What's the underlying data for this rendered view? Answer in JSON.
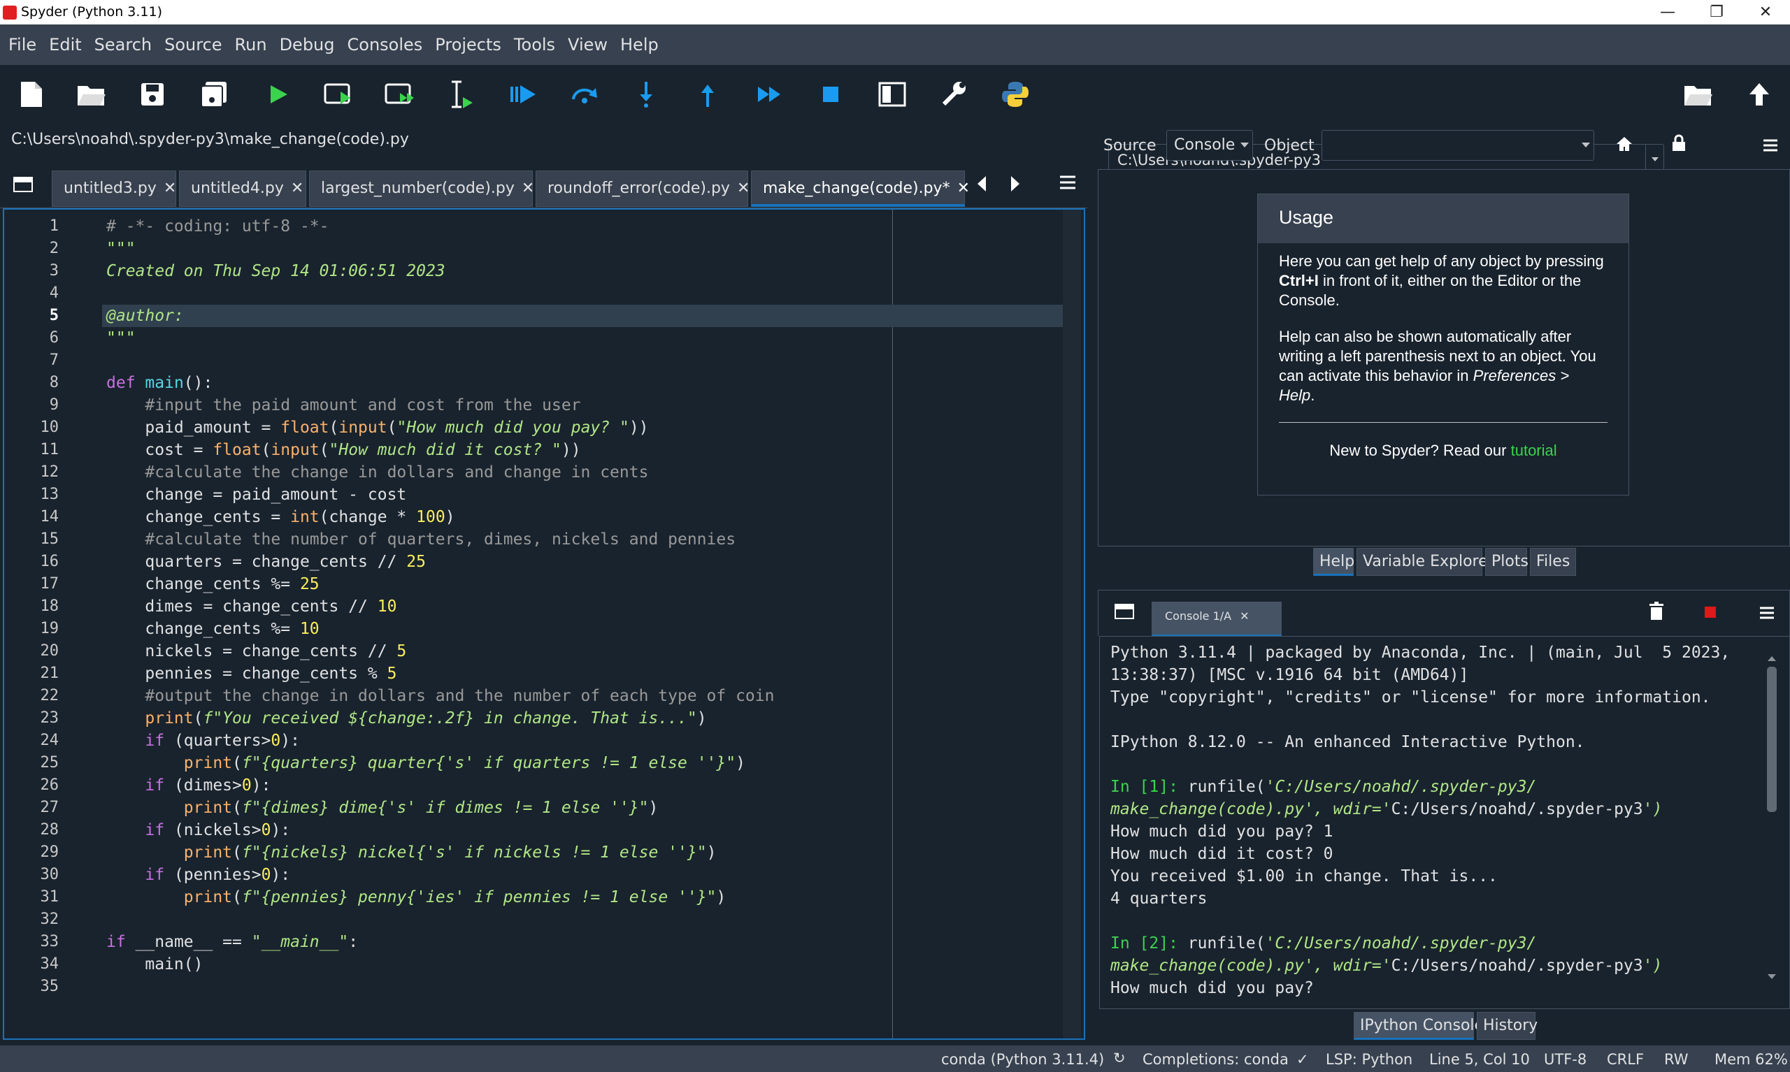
{
  "window": {
    "title": "Spyder (Python 3.11)"
  },
  "menu": [
    "File",
    "Edit",
    "Search",
    "Source",
    "Run",
    "Debug",
    "Consoles",
    "Projects",
    "Tools",
    "View",
    "Help"
  ],
  "working_dir": "C:\\Users\\noahd\\.spyder-py3",
  "editor": {
    "file_path": "C:\\Users\\noahd\\.spyder-py3\\make_change(code).py",
    "tabs": [
      "untitled3.py",
      "untitled4.py",
      "largest_number(code).py",
      "roundoff_error(code).py",
      "make_change(code).py*"
    ],
    "active_tab": 4,
    "current_line": 5,
    "lines": [
      "# -*- coding: utf-8 -*-",
      "\"\"\"",
      "Created on Thu Sep 14 01:06:51 2023",
      "",
      "@author:",
      "\"\"\"",
      "",
      "def main():",
      "    #input the paid amount and cost from the user",
      "    paid_amount = float(input(\"How much did you pay? \"))",
      "    cost = float(input(\"How much did it cost? \"))",
      "    #calculate the change in dollars and change in cents",
      "    change = paid_amount - cost",
      "    change_cents = int(change * 100)",
      "    #calculate the number of quarters, dimes, nickels and pennies",
      "    quarters = change_cents // 25",
      "    change_cents %= 25",
      "    dimes = change_cents // 10",
      "    change_cents %= 10",
      "    nickels = change_cents // 5",
      "    pennies = change_cents % 5",
      "    #output the change in dollars and the number of each type of coin",
      "    print(f\"You received ${change:.2f} in change. That is...\")",
      "    if (quarters>0):",
      "        print(f\"{quarters} quarter{'s' if quarters != 1 else ''}\")",
      "    if (dimes>0):",
      "        print(f\"{dimes} dime{'s' if dimes != 1 else ''}\")",
      "    if (nickels>0):",
      "        print(f\"{nickels} nickel{'s' if nickels != 1 else ''}\")",
      "    if (pennies>0):",
      "        print(f\"{pennies} penny{'ies' if pennies != 1 else ''}\")",
      "",
      "if __name__ == \"__main__\":",
      "    main()",
      ""
    ]
  },
  "help": {
    "source_label": "Source",
    "source_value": "Console",
    "object_label": "Object",
    "object_value": "",
    "usage_title": "Usage",
    "p1a": "Here you can get help of any object by pressing ",
    "p1b": "Ctrl+I",
    "p1c": " in front of it, either on the Editor or the Console.",
    "p2a": "Help can also be shown automatically after writing a left parenthesis next to an object. You can activate this behavior in ",
    "p2b": "Preferences > Help",
    "p2c": ".",
    "new_text": "New to Spyder? Read our ",
    "tutorial": "tutorial",
    "tabs": [
      "Help",
      "Variable Explorer",
      "Plots",
      "Files"
    ]
  },
  "console": {
    "tab": "Console 1/A",
    "lines": [
      "Python 3.11.4 | packaged by Anaconda, Inc. | (main, Jul  5 2023,",
      "13:38:37) [MSC v.1916 64 bit (AMD64)]",
      "Type \"copyright\", \"credits\" or \"license\" for more information.",
      "",
      "IPython 8.12.0 -- An enhanced Interactive Python.",
      "",
      "In [1]: runfile('C:/Users/noahd/.spyder-py3/",
      "make_change(code).py', wdir='C:/Users/noahd/.spyder-py3')",
      "How much did you pay? 1",
      "How much did it cost? 0",
      "You received $1.00 in change. That is...",
      "4 quarters",
      "",
      "In [2]: runfile('C:/Users/noahd/.spyder-py3/",
      "make_change(code).py', wdir='C:/Users/noahd/.spyder-py3')",
      "How much did you pay?"
    ],
    "tabs": [
      "IPython Console",
      "History"
    ]
  },
  "status": {
    "env": "conda (Python 3.11.4)",
    "completions": "Completions: conda",
    "lsp": "LSP: Python",
    "position": "Line 5, Col 10",
    "encoding": "UTF-8",
    "eol": "CRLF",
    "mode": "RW",
    "mem": "Mem 62%"
  },
  "colors": {
    "accent": "#1a72bb",
    "keyword": "#c670e0",
    "string": "#b0e686",
    "number": "#faed5c",
    "comment": "#999999",
    "prompt": "#3bd34e",
    "link": "#3bd34e"
  }
}
